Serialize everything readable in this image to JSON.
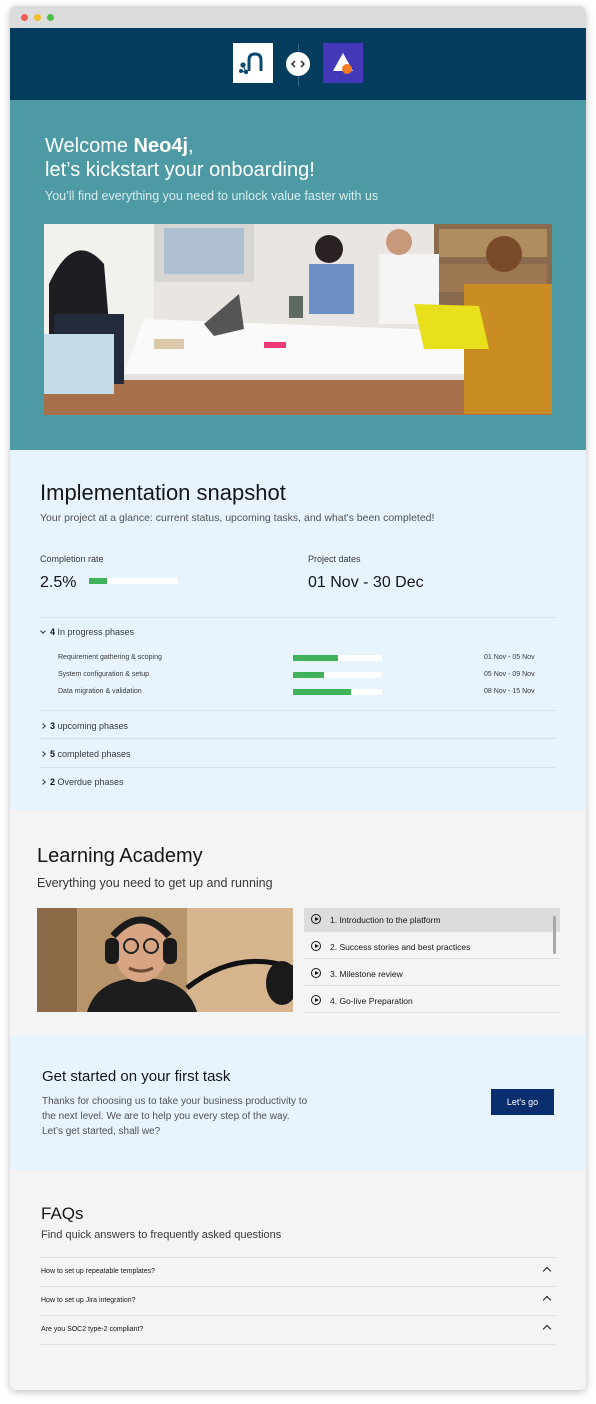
{
  "hero": {
    "welcome": "Welcome ",
    "company": "Neo4j",
    "comma": ",",
    "line2": "let’s kickstart your onboarding!",
    "subtitle": "You’ll find everything you need to unlock value faster with us"
  },
  "snapshot": {
    "title": "Implementation snapshot",
    "subtitle": "Your project at a glance: current status, upcoming tasks, and what's been completed!",
    "completion_label": "Completion rate",
    "completion_value": "2.5%",
    "completion_fraction": 0.2,
    "dates_label": "Project dates",
    "dates_value": "01 Nov - 30 Dec",
    "in_progress": {
      "count": "4",
      "label": " In progress phases"
    },
    "phases": [
      {
        "name": "Requirement gathering & scoping",
        "progress": 0.5,
        "dates": "01 Nov - 05 Nov"
      },
      {
        "name": "System configuration & setup",
        "progress": 0.35,
        "dates": "05 Nov - 09 Nov"
      },
      {
        "name": "Data migration & validation",
        "progress": 0.65,
        "dates": "08 Nov - 15 Nov"
      }
    ],
    "groups": [
      {
        "count": "3",
        "label": " upcoming phases"
      },
      {
        "count": "5",
        "label": " completed phases"
      },
      {
        "count": "2",
        "label": " Overdue phases"
      }
    ],
    "accent_color": "#3fb25a"
  },
  "academy": {
    "title": "Learning Academy",
    "subtitle": "Everything you need to get up and running",
    "lessons": [
      {
        "label": "1. Introduction to the platform"
      },
      {
        "label": "2. Success stories and best practices"
      },
      {
        "label": "3. Milestone review"
      },
      {
        "label": "4. Go-live Preparation"
      }
    ]
  },
  "task": {
    "title": "Get started on your first task",
    "body": "Thanks for choosing us to take your business productivity to the next level. We are to help you every step of the way. Let’s get started, shall we?",
    "button": "Let's go"
  },
  "faq": {
    "title": "FAQs",
    "subtitle": "Find quick answers to frequently asked questions",
    "items": [
      {
        "q": "How to set up repeatable templates?"
      },
      {
        "q": "How to set up Jira integration?"
      },
      {
        "q": "Are you SOC2 type-2 compliant?"
      }
    ]
  },
  "colors": {
    "header_bg": "#033c5c",
    "hero_bg": "#4e9aa4",
    "section_light": "#e7f4fd",
    "button_bg": "#0a2d6e"
  }
}
